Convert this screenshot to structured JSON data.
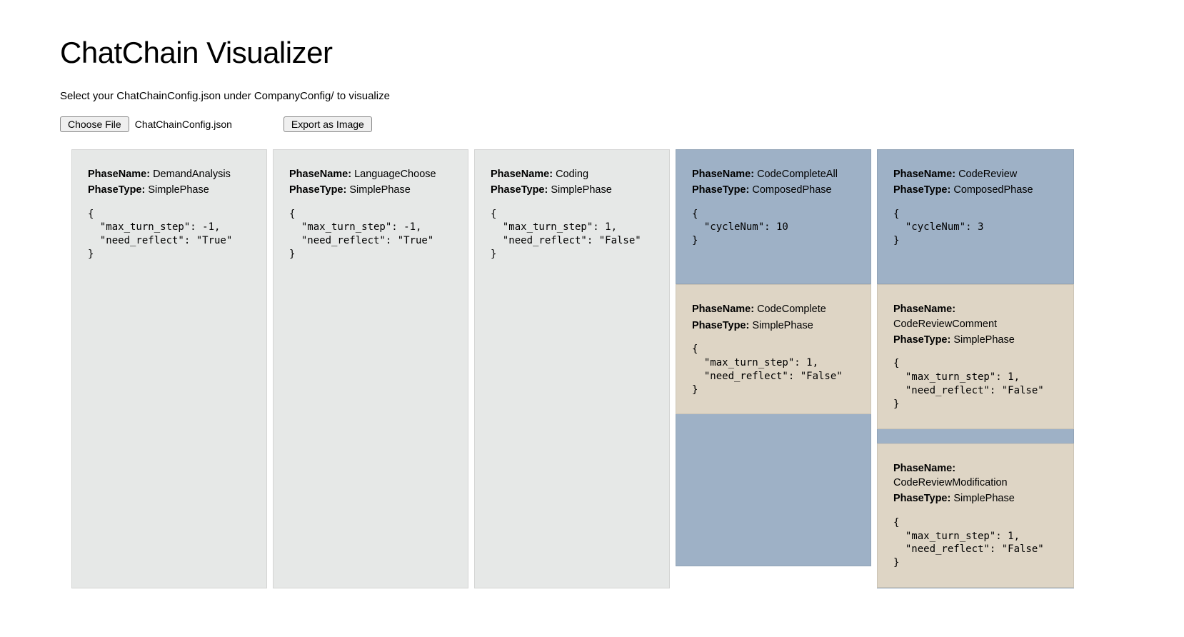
{
  "page": {
    "title": "ChatChain Visualizer",
    "subtitle": "Select your ChatChainConfig.json under CompanyConfig/ to visualize"
  },
  "controls": {
    "choose_file_label": "Choose File",
    "filename": "ChatChainConfig.json",
    "export_label": "Export as Image"
  },
  "labels": {
    "phase_name": "PhaseName:",
    "phase_type": "PhaseType:"
  },
  "columns": [
    {
      "type": "simple",
      "card": {
        "phaseName": "DemandAnalysis",
        "phaseType": "SimplePhase",
        "json": "{\n  \"max_turn_step\": -1,\n  \"need_reflect\": \"True\"\n}"
      }
    },
    {
      "type": "simple",
      "card": {
        "phaseName": "LanguageChoose",
        "phaseType": "SimplePhase",
        "json": "{\n  \"max_turn_step\": -1,\n  \"need_reflect\": \"True\"\n}"
      }
    },
    {
      "type": "simple",
      "card": {
        "phaseName": "Coding",
        "phaseType": "SimplePhase",
        "json": "{\n  \"max_turn_step\": 1,\n  \"need_reflect\": \"False\"\n}"
      }
    },
    {
      "type": "composed",
      "header": {
        "phaseName": "CodeCompleteAll",
        "phaseType": "ComposedPhase",
        "json": "{\n  \"cycleNum\": 10\n}"
      },
      "children": [
        {
          "phaseName": "CodeComplete",
          "phaseType": "SimplePhase",
          "json": "{\n  \"max_turn_step\": 1,\n  \"need_reflect\": \"False\"\n}"
        }
      ]
    },
    {
      "type": "composed",
      "header": {
        "phaseName": "CodeReview",
        "phaseType": "ComposedPhase",
        "json": "{\n  \"cycleNum\": 3\n}"
      },
      "children": [
        {
          "phaseName": "CodeReviewComment",
          "phaseType": "SimplePhase",
          "json": "{\n  \"max_turn_step\": 1,\n  \"need_reflect\": \"False\"\n}"
        },
        {
          "phaseName": "CodeReviewModification",
          "phaseType": "SimplePhase",
          "json": "{\n  \"max_turn_step\": 1,\n  \"need_reflect\": \"False\"\n}"
        }
      ]
    }
  ]
}
